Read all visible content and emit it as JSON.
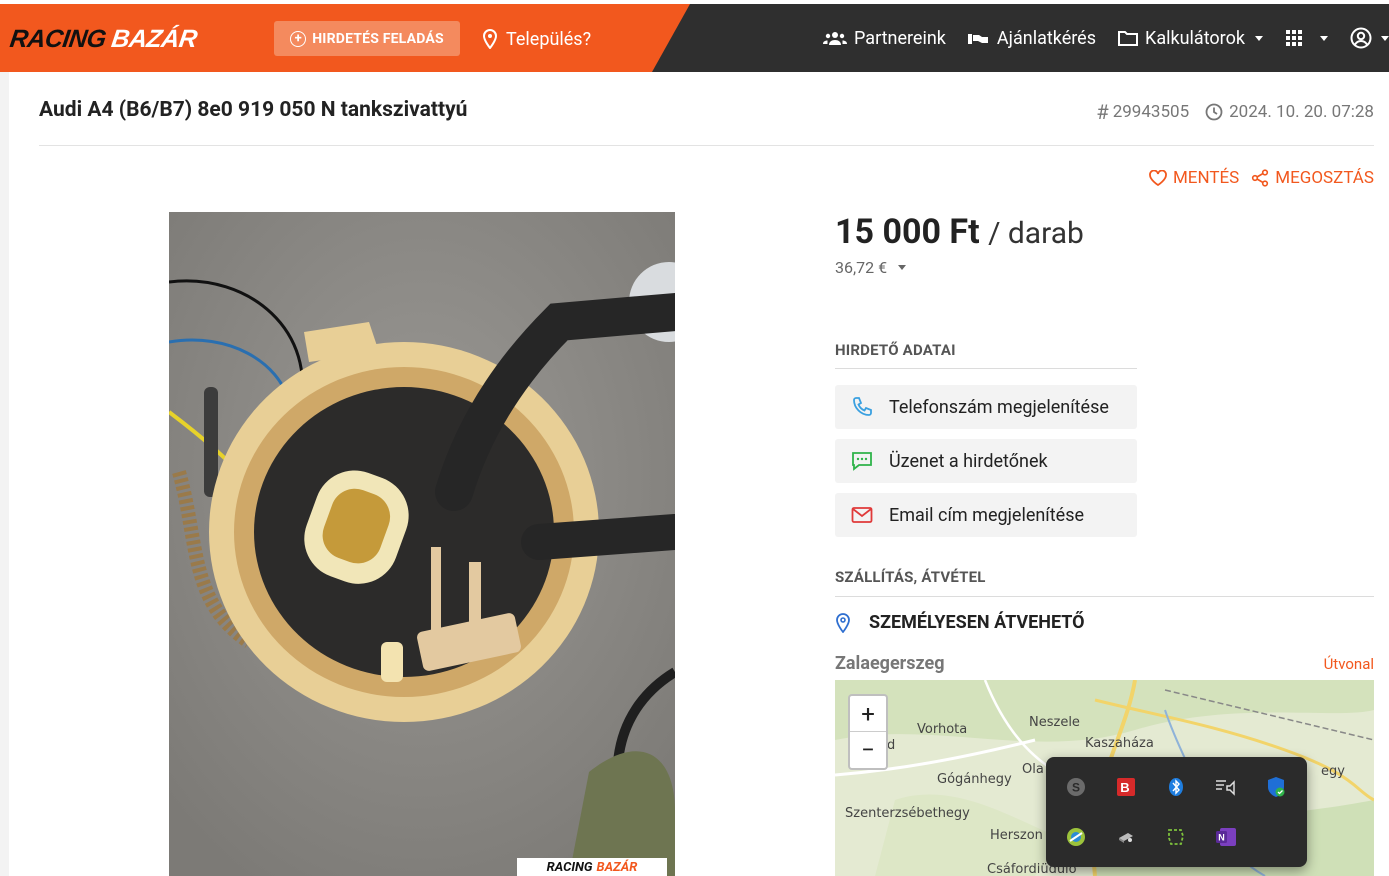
{
  "header": {
    "logo": {
      "part1": "RACING",
      "part2": "BAZÁR"
    },
    "post_button": "HIRDETÉS FELADÁS",
    "location_placeholder": "Település?",
    "nav": {
      "partners": "Partnereink",
      "quote": "Ajánlatkérés",
      "calculators": "Kalkulátorok"
    },
    "colors": {
      "brand": "#f2581e",
      "dark": "#2f2f2f"
    }
  },
  "listing": {
    "title": "Audi A4 (B6/B7) 8e0 919 050 N tankszivattyú",
    "id": "29943505",
    "date": "2024. 10. 20. 07:28",
    "save_label": "MENTÉS",
    "share_label": "MEGOSZTÁS",
    "price": "15 000 Ft",
    "price_unit": "/ darab",
    "price_eur": "36,72 €",
    "watermark": {
      "part1": "RACING",
      "part2": "BAZÁR"
    }
  },
  "advertiser": {
    "heading": "HIRDETŐ ADATAI",
    "phone_button": "Telefonszám megjelenítése",
    "message_button": "Üzenet a hirdetőnek",
    "email_button": "Email cím megjelenítése"
  },
  "delivery": {
    "heading": "SZÁLLÍTÁS, ÁTVÉTEL",
    "pickup_label": "SZEMÉLYESEN ÁTVEHETŐ",
    "city": "Zalaegerszeg",
    "route_link": "Útvonal"
  },
  "map": {
    "zoom_in": "+",
    "zoom_out": "−",
    "labels": {
      "neszele": "Neszele",
      "vorhota": "Vorhota",
      "kaszahaza": "Kaszaháza",
      "goganhegy": "Gógánhegy",
      "szenterzsebethegy": "Szenterzsébethegy",
      "herszon": "Herszon",
      "csafordiudulo": "Csáfordiüdülő",
      "ola": "Ola",
      "egy": "egy",
      "d": "d"
    }
  },
  "tray": {
    "icons": [
      "skype-icon",
      "foxit-icon",
      "bluetooth-icon",
      "audio-icon",
      "defender-icon",
      "greenshot-icon",
      "network-drive-icon",
      "snip-icon",
      "onenote-icon"
    ]
  }
}
